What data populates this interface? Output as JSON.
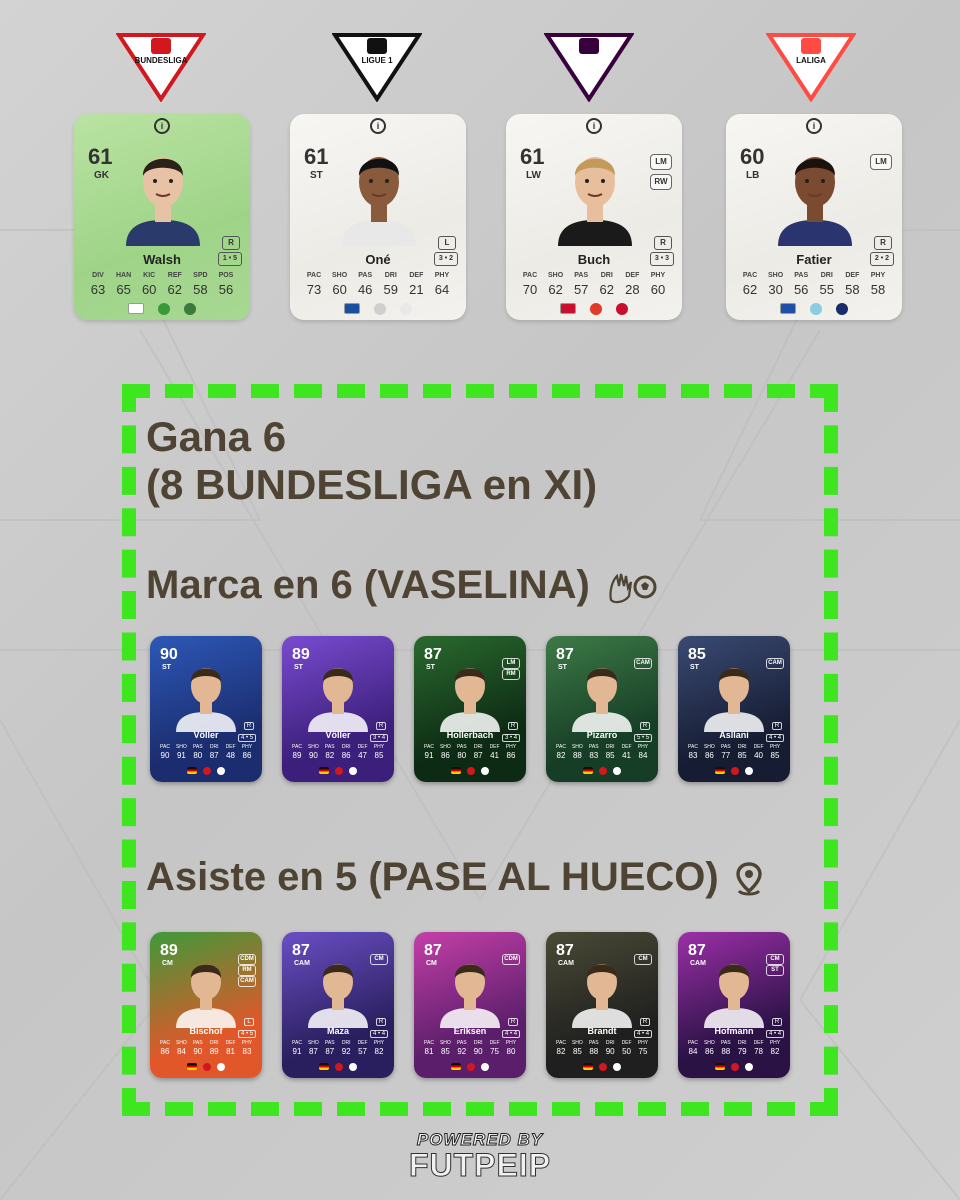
{
  "leagues": [
    {
      "name": "BUNDESLIGA",
      "color": "#d3171f",
      "fill": "#ffffff"
    },
    {
      "name": "LIGUE 1",
      "color": "#111111",
      "fill": "#ffffff"
    },
    {
      "name": "",
      "color": "#38003c",
      "fill": "#ffffff"
    },
    {
      "name": "LALIGA",
      "color": "#ff4b44",
      "fill": "#ffffff"
    }
  ],
  "top_cards": [
    {
      "rating": "61",
      "position": "GK",
      "alt_positions": [],
      "name": "Walsh",
      "foot": "R",
      "skills": "1 • 5",
      "stat_labels": [
        "DIV",
        "HAN",
        "KIC",
        "REF",
        "SPD",
        "POS"
      ],
      "stat_values": [
        "63",
        "65",
        "60",
        "62",
        "58",
        "56"
      ],
      "style": "green"
    },
    {
      "rating": "61",
      "position": "ST",
      "alt_positions": [],
      "name": "Oné",
      "foot": "L",
      "skills": "3 • 2",
      "stat_labels": [
        "PAC",
        "SHO",
        "PAS",
        "DRI",
        "DEF",
        "PHY"
      ],
      "stat_values": [
        "73",
        "60",
        "46",
        "59",
        "21",
        "64"
      ],
      "style": "white"
    },
    {
      "rating": "61",
      "position": "LW",
      "alt_positions": [
        "LM",
        "RW"
      ],
      "name": "Buch",
      "foot": "R",
      "skills": "3 • 3",
      "stat_labels": [
        "PAC",
        "SHO",
        "PAS",
        "DRI",
        "DEF",
        "PHY"
      ],
      "stat_values": [
        "70",
        "62",
        "57",
        "62",
        "28",
        "60"
      ],
      "style": "white"
    },
    {
      "rating": "60",
      "position": "LB",
      "alt_positions": [
        "LM"
      ],
      "name": "Fatier",
      "foot": "R",
      "skills": "2 • 2",
      "stat_labels": [
        "PAC",
        "SHO",
        "PAS",
        "DRI",
        "DEF",
        "PHY"
      ],
      "stat_values": [
        "62",
        "30",
        "56",
        "55",
        "58",
        "58"
      ],
      "style": "white"
    }
  ],
  "objectives": {
    "win": "Gana 6\n(8 BUNDESLIGA en XI)",
    "score": "Marca en 6  (VASELINA)",
    "assist": "Asiste en 5 (PASE AL HUECO)"
  },
  "score_cards": [
    {
      "rating": "90",
      "position": "ST",
      "alt_positions": [],
      "name": "Völler",
      "foot": "R",
      "skills": "4 • 5",
      "values": [
        "90",
        "91",
        "80",
        "87",
        "48",
        "86"
      ],
      "bg": [
        "#1b2d6e",
        "#2d58b8"
      ]
    },
    {
      "rating": "89",
      "position": "ST",
      "alt_positions": [],
      "name": "Völler",
      "foot": "R",
      "skills": "3 • 4",
      "values": [
        "89",
        "90",
        "82",
        "86",
        "47",
        "85"
      ],
      "bg": [
        "#3b1f7a",
        "#7a4bd0"
      ]
    },
    {
      "rating": "87",
      "position": "ST",
      "alt_positions": [
        "LM",
        "RM"
      ],
      "name": "Hollerbach",
      "foot": "R",
      "skills": "3 • 4",
      "values": [
        "91",
        "86",
        "80",
        "87",
        "41",
        "86"
      ],
      "bg": [
        "#0d2a14",
        "#2a6a2e"
      ]
    },
    {
      "rating": "87",
      "position": "ST",
      "alt_positions": [
        "CAM"
      ],
      "name": "Pizarro",
      "foot": "R",
      "skills": "5 • 5",
      "values": [
        "82",
        "88",
        "83",
        "85",
        "41",
        "84"
      ],
      "bg": [
        "#163d26",
        "#3d7a46"
      ]
    },
    {
      "rating": "85",
      "position": "ST",
      "alt_positions": [
        "CAM"
      ],
      "name": "Asllani",
      "foot": "R",
      "skills": "4 • 4",
      "values": [
        "83",
        "86",
        "77",
        "85",
        "40",
        "85"
      ],
      "bg": [
        "#161d33",
        "#3a4a73"
      ]
    }
  ],
  "assist_cards": [
    {
      "rating": "89",
      "position": "CM",
      "alt_positions": [
        "CDM",
        "RM",
        "CAM"
      ],
      "name": "Bischof",
      "foot": "L",
      "skills": "4 • 5",
      "values": [
        "86",
        "84",
        "90",
        "89",
        "81",
        "83"
      ],
      "bg": [
        "#e1572a",
        "#3d9a3a"
      ]
    },
    {
      "rating": "87",
      "position": "CAM",
      "alt_positions": [
        "CM"
      ],
      "name": "Maza",
      "foot": "R",
      "skills": "4 • 4",
      "values": [
        "91",
        "87",
        "87",
        "92",
        "57",
        "82"
      ],
      "bg": [
        "#2a1f5e",
        "#6a4fc4"
      ]
    },
    {
      "rating": "87",
      "position": "CM",
      "alt_positions": [
        "CDM"
      ],
      "name": "Eriksen",
      "foot": "R",
      "skills": "4 • 4",
      "values": [
        "81",
        "85",
        "92",
        "90",
        "75",
        "80"
      ],
      "bg": [
        "#5a1e6a",
        "#c43fa8"
      ]
    },
    {
      "rating": "87",
      "position": "CAM",
      "alt_positions": [
        "CM"
      ],
      "name": "Brandt",
      "foot": "R",
      "skills": "4 • 4",
      "values": [
        "82",
        "85",
        "88",
        "90",
        "50",
        "75"
      ],
      "bg": [
        "#1f1f1f",
        "#4a4a36"
      ]
    },
    {
      "rating": "87",
      "position": "CAM",
      "alt_positions": [
        "CM",
        "ST"
      ],
      "name": "Hofmann",
      "foot": "R",
      "skills": "4 • 4",
      "values": [
        "84",
        "86",
        "88",
        "79",
        "78",
        "82"
      ],
      "bg": [
        "#2a1245",
        "#9c2fa8"
      ]
    }
  ],
  "small_stat_labels": [
    "PAC",
    "SHO",
    "PAS",
    "DRI",
    "DEF",
    "PHY"
  ],
  "powered_by": "POWERED BY",
  "brand": "FUTPEIP",
  "accent_color": "#3ee620",
  "heading_color": "#4f4433"
}
